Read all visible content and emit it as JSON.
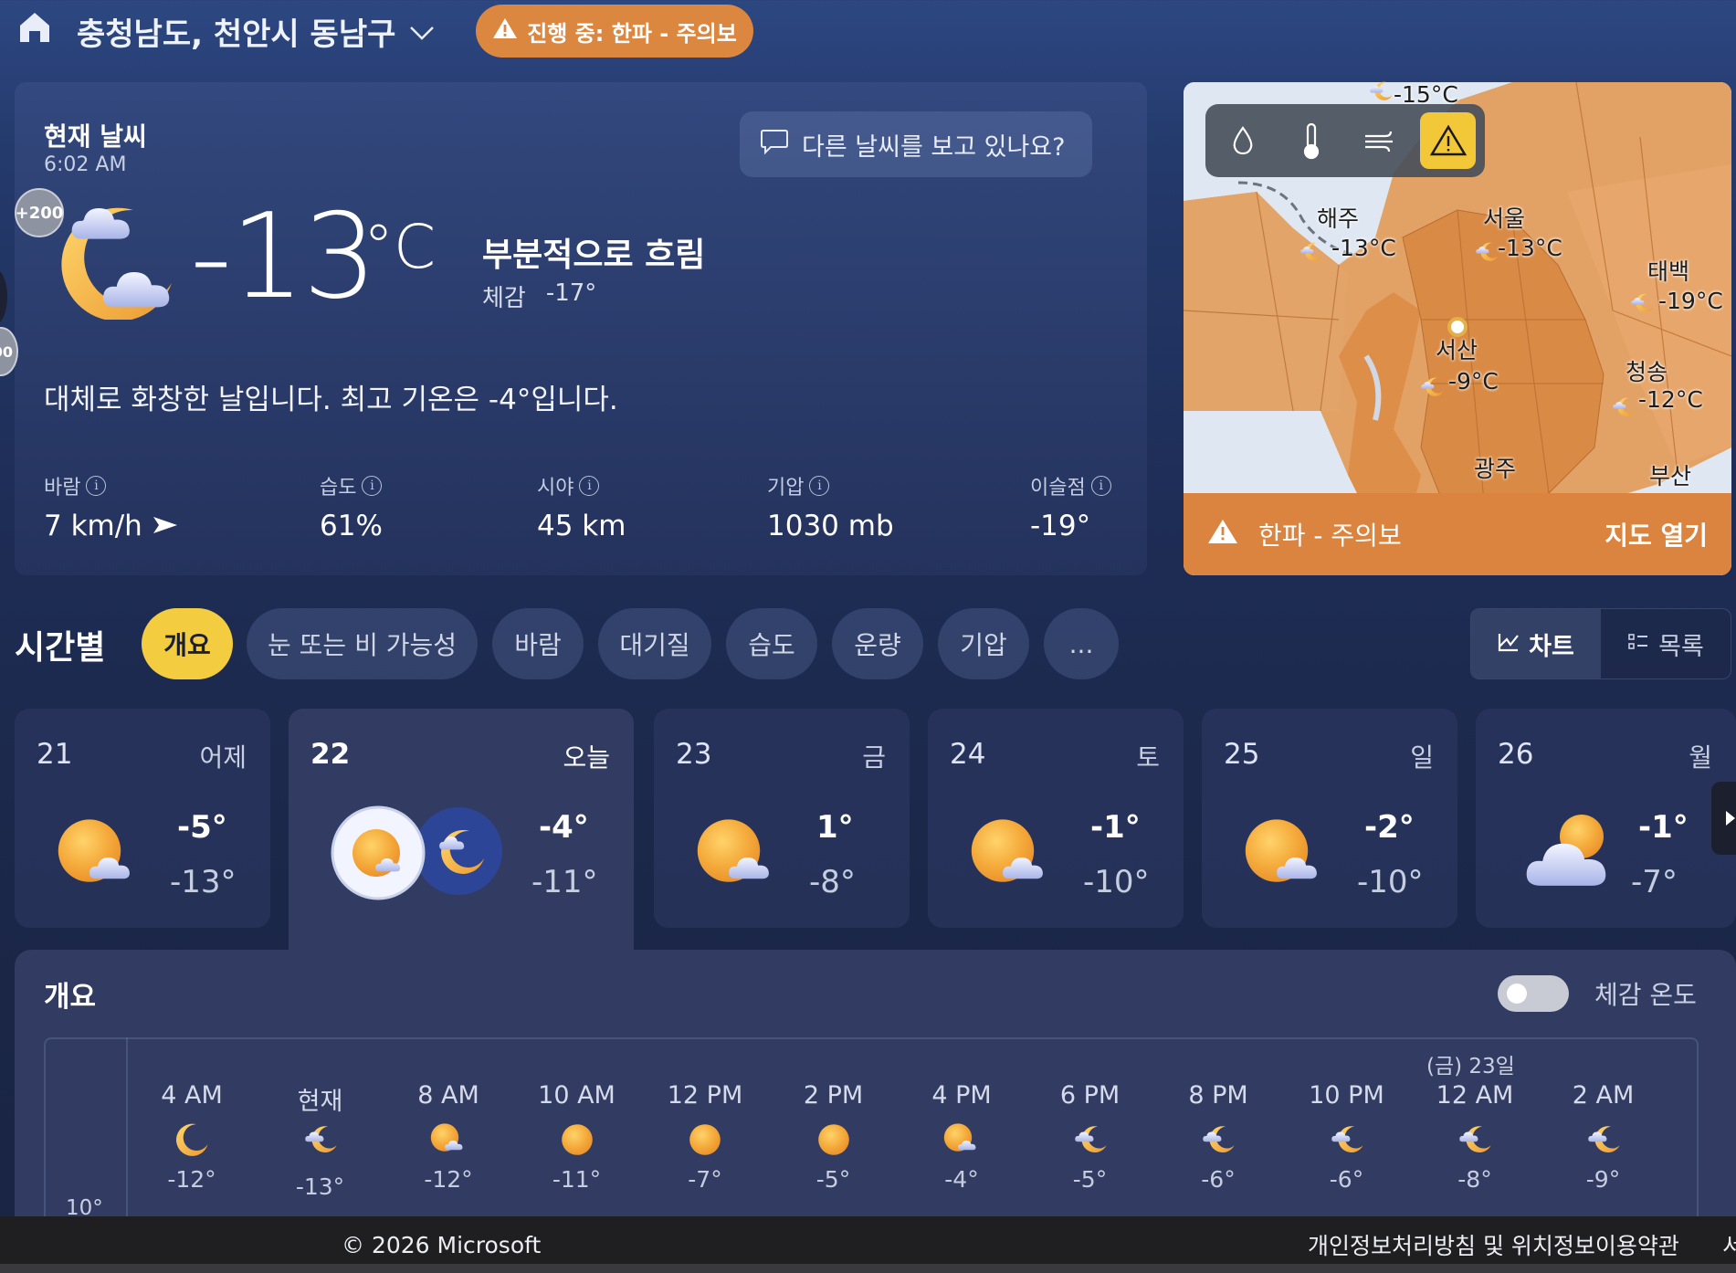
{
  "header": {
    "location": "충청남도, 천안시 동남구",
    "alert": "진행 중: 한파 - 주의보"
  },
  "current": {
    "title": "현재 날씨",
    "time": "6:02 AM",
    "other_weather_prompt": "다른 날씨를 보고 있나요?",
    "badge": "+200",
    "side_badge": "00",
    "temp": "-13",
    "unit": "°C",
    "condition": "부분적으로 흐림",
    "feels_label": "체감",
    "feels_value": "-17°",
    "summary": "대체로 화창한 날입니다. 최고 기온은 -4°입니다.",
    "stats": [
      {
        "label": "바람",
        "value": "7 km/h"
      },
      {
        "label": "습도",
        "value": "61%"
      },
      {
        "label": "시야",
        "value": "45 km"
      },
      {
        "label": "기압",
        "value": "1030 mb"
      },
      {
        "label": "이슬점",
        "value": "-19°"
      }
    ]
  },
  "map": {
    "tools": [
      "drop-icon",
      "thermometer-icon",
      "wind-icon",
      "warning-icon"
    ],
    "cities": [
      {
        "name": "",
        "temp": "-15°C"
      },
      {
        "name": "해주",
        "temp": "-13°C"
      },
      {
        "name": "서울",
        "temp": "-13°C"
      },
      {
        "name": "태백",
        "temp": "-19°C"
      },
      {
        "name": "서산",
        "temp": "-9°C"
      },
      {
        "name": "청송",
        "temp": "-12°C"
      },
      {
        "name": "광주",
        "temp": ""
      },
      {
        "name": "부산",
        "temp": ""
      }
    ],
    "alert_label": "한파 - 주의보",
    "open_map": "지도 열기"
  },
  "hourly": {
    "title": "시간별",
    "chips": [
      "개요",
      "눈 또는 비 가능성",
      "바람",
      "대기질",
      "습도",
      "운량",
      "기압",
      "..."
    ],
    "active_chip": "개요",
    "view_chart": "차트",
    "view_list": "목록"
  },
  "days": [
    {
      "num": "21",
      "name": "어제",
      "hi": "-5°",
      "lo": "-13°",
      "icon": "sun-cloud-icon"
    },
    {
      "num": "22",
      "name": "오늘",
      "hi": "-4°",
      "lo": "-11°",
      "icon": "sun-moon-pair-icon"
    },
    {
      "num": "23",
      "name": "금",
      "hi": "1°",
      "lo": "-8°",
      "icon": "sun-cloud-icon"
    },
    {
      "num": "24",
      "name": "토",
      "hi": "-1°",
      "lo": "-10°",
      "icon": "sun-cloud-icon"
    },
    {
      "num": "25",
      "name": "일",
      "hi": "-2°",
      "lo": "-10°",
      "icon": "sun-cloud-icon"
    },
    {
      "num": "26",
      "name": "월",
      "hi": "-1°",
      "lo": "-7°",
      "icon": "cloudy-icon"
    }
  ],
  "overview": {
    "title": "개요",
    "feels_toggle": "체감 온도",
    "date_label": "(금) 23일",
    "y_tick": "10°",
    "hours": [
      {
        "t": "4 AM",
        "temp": "-12°",
        "icon": "moon"
      },
      {
        "t": "현재",
        "temp": "-13°",
        "icon": "moon-cloud"
      },
      {
        "t": "8 AM",
        "temp": "-12°",
        "icon": "sun-cloud"
      },
      {
        "t": "10 AM",
        "temp": "-11°",
        "icon": "sun"
      },
      {
        "t": "12 PM",
        "temp": "-7°",
        "icon": "sun"
      },
      {
        "t": "2 PM",
        "temp": "-5°",
        "icon": "sun"
      },
      {
        "t": "4 PM",
        "temp": "-4°",
        "icon": "sun-cloud"
      },
      {
        "t": "6 PM",
        "temp": "-5°",
        "icon": "moon-cloud"
      },
      {
        "t": "8 PM",
        "temp": "-6°",
        "icon": "moon-cloud"
      },
      {
        "t": "10 PM",
        "temp": "-6°",
        "icon": "moon-cloud"
      },
      {
        "t": "12 AM",
        "temp": "-8°",
        "icon": "moon-cloud"
      },
      {
        "t": "2 AM",
        "temp": "-9°",
        "icon": "moon-cloud"
      }
    ]
  },
  "footer": {
    "copyright": "© 2026 Microsoft",
    "privacy": "개인정보처리방침 및 위치정보이용약관",
    "cut": "서"
  }
}
